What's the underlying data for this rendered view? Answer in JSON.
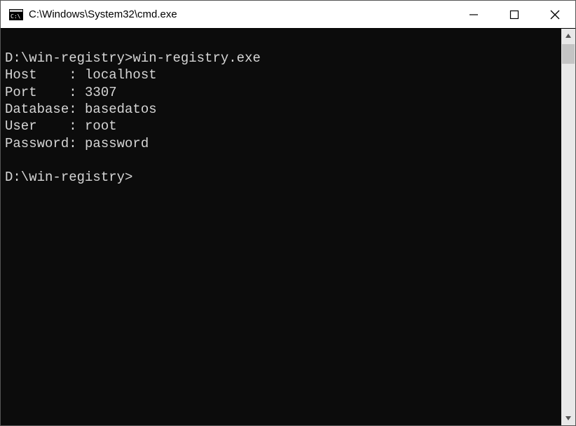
{
  "titlebar": {
    "title": "C:\\Windows\\System32\\cmd.exe"
  },
  "terminal": {
    "prompt1_path": "D:\\win-registry>",
    "prompt1_cmd": "win-registry.exe",
    "lines": {
      "host": "Host    : localhost",
      "port": "Port    : 3307",
      "database": "Database: basedatos",
      "user": "User    : root",
      "password": "Password: password"
    },
    "prompt2_path": "D:\\win-registry>"
  }
}
